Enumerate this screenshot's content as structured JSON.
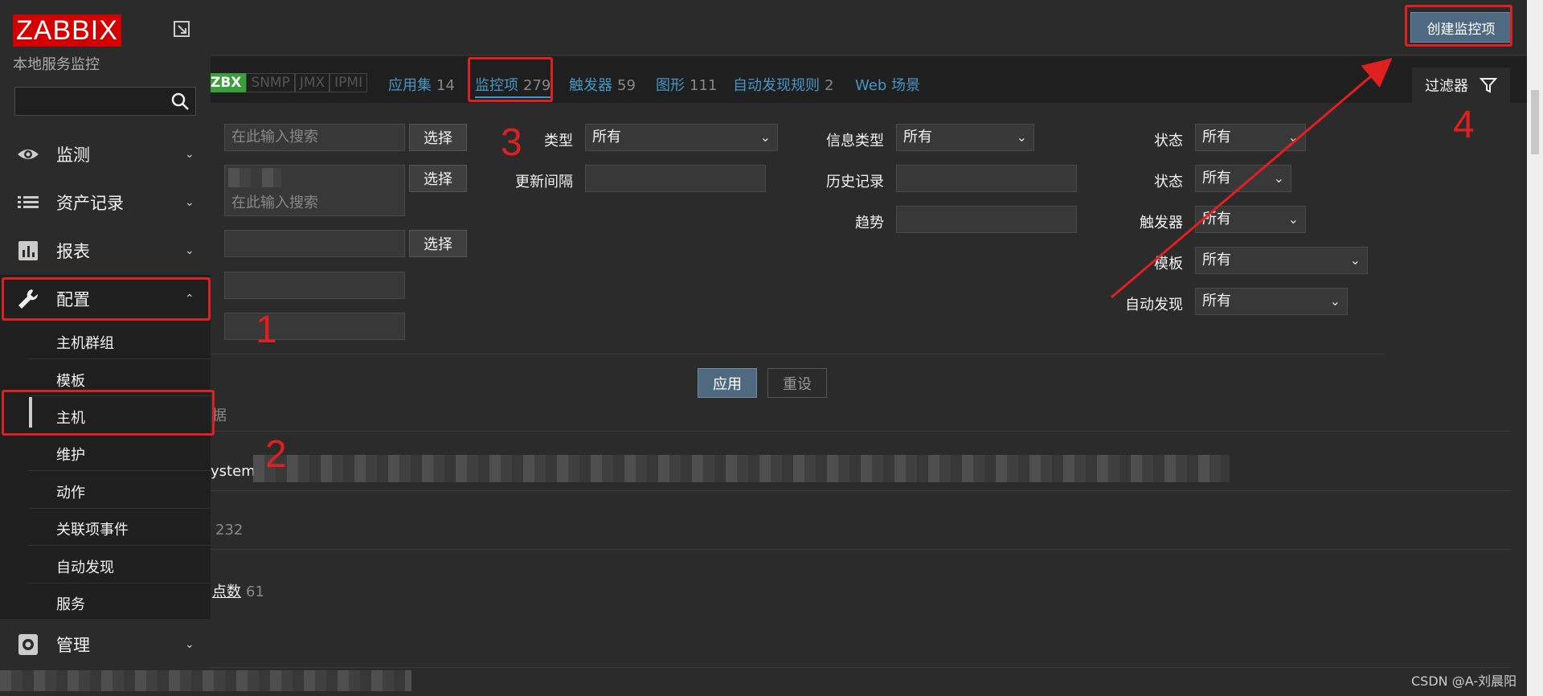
{
  "header": {
    "create_button": "创建监控项"
  },
  "tabs": {
    "availability": [
      "ZBX",
      "SNMP",
      "JMX",
      "IPMI"
    ],
    "items": [
      {
        "label": "应用集",
        "count": "14"
      },
      {
        "label": "监控项",
        "count": "279"
      },
      {
        "label": "触发器",
        "count": "59"
      },
      {
        "label": "图形",
        "count": "111"
      },
      {
        "label": "自动发现规则",
        "count": "2"
      },
      {
        "label": "Web 场景",
        "count": ""
      }
    ],
    "filter_label": "过滤器"
  },
  "filter": {
    "search_placeholder": "在此输入搜索",
    "select_button": "选择",
    "type_label": "类型",
    "type_value": "所有",
    "interval_label": "更新间隔",
    "info_type_label": "信息类型",
    "info_type_value": "所有",
    "history_label": "历史记录",
    "trend_label": "趋势",
    "status_label": "状态",
    "status_value": "所有",
    "state_label": "状态",
    "state_value": "所有",
    "trigger_label": "触发器",
    "trigger_value": "所有",
    "template_label": "模板",
    "template_value": "所有",
    "discovery_label": "自动发现",
    "discovery_value": "所有",
    "apply": "应用",
    "reset": "重设"
  },
  "subfilter": {
    "partial_label": "据",
    "row1": "ystem",
    "row2_count": "232",
    "row3_label": "点数",
    "row3_count": "61"
  },
  "sidebar": {
    "logo": "ZABBIX",
    "subtitle": "本地服务监控",
    "menu": [
      "监测",
      "资产记录",
      "报表",
      "配置",
      "管理"
    ],
    "submenu": [
      "主机群组",
      "模板",
      "主机",
      "维护",
      "动作",
      "关联项事件",
      "自动发现",
      "服务"
    ]
  },
  "annotations": [
    "1",
    "2",
    "3",
    "4"
  ],
  "watermark": "CSDN @A-刘晨阳",
  "colors": {
    "annotation": "#e02020",
    "link": "#4796c4",
    "logo": "#d40000"
  }
}
